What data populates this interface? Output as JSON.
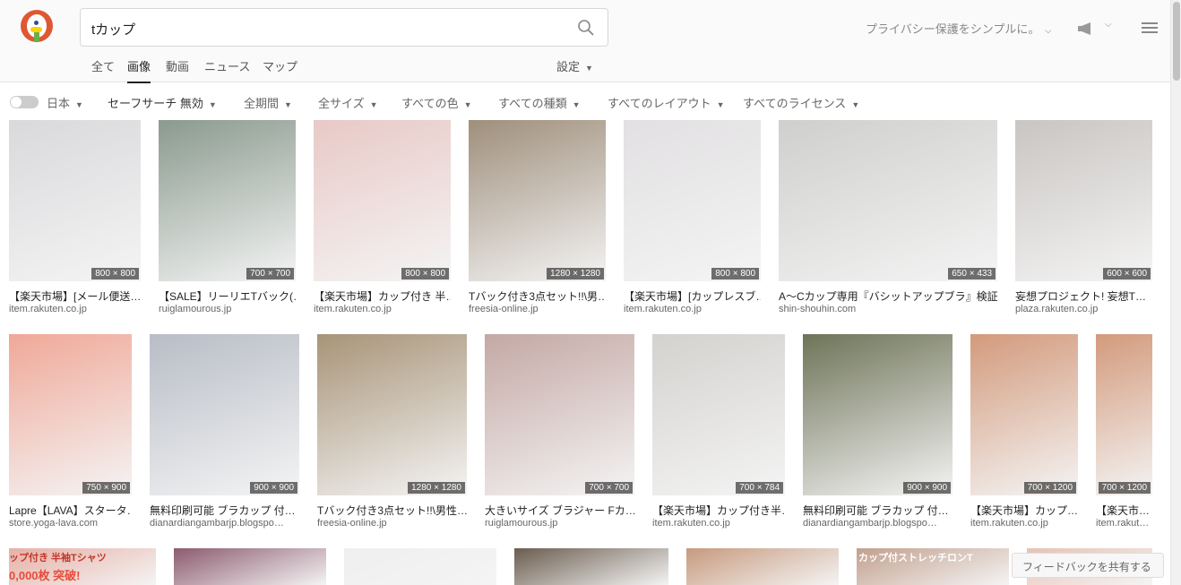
{
  "search": {
    "query": "tカップ"
  },
  "header": {
    "tagline": "プライバシー保護をシンプルに。"
  },
  "tabs": [
    {
      "label": "全て"
    },
    {
      "label": "画像"
    },
    {
      "label": "動画"
    },
    {
      "label": "ニュース"
    },
    {
      "label": "マップ"
    }
  ],
  "settings_label": "設定",
  "filters": [
    {
      "label": "日本"
    },
    {
      "label": "セーフサーチ 無効"
    },
    {
      "label": "全期間"
    },
    {
      "label": "全サイズ"
    },
    {
      "label": "すべての色"
    },
    {
      "label": "すべての種類"
    },
    {
      "label": "すべてのレイアウト"
    },
    {
      "label": "すべてのライセンス"
    }
  ],
  "results_row1": [
    {
      "title": "【楽天市場】[メール便送…",
      "source": "item.rakuten.co.jp",
      "dims": "800 × 800",
      "color": "#d9d9dc"
    },
    {
      "title": "【SALE】リーリエTバック(…",
      "source": "ruiglamourous.jp",
      "dims": "700 × 700",
      "color": "#8a9a8e"
    },
    {
      "title": "【楽天市場】カップ付き 半…",
      "source": "item.rakuten.co.jp",
      "dims": "800 × 800",
      "color": "#e8c9c6"
    },
    {
      "title": "Tバック付き3点セット!!\\男…",
      "source": "freesia-online.jp",
      "dims": "1280 × 1280",
      "color": "#9f8f7c"
    },
    {
      "title": "【楽天市場】[カップレスブ…",
      "source": "item.rakuten.co.jp",
      "dims": "800 × 800",
      "color": "#e2e0e2"
    },
    {
      "title": "A〜Cカップ専用『バシットアップブラ』検証…",
      "source": "shin-shouhin.com",
      "dims": "650 × 433",
      "color": "#cfcfcd"
    },
    {
      "title": "妄想プロジェクト! 妄想T…",
      "source": "plaza.rakuten.co.jp",
      "dims": "600 × 600",
      "color": "#c9c5c2"
    }
  ],
  "results_row2": [
    {
      "title": "Lapre【LAVA】スタータ…",
      "source": "store.yoga-lava.com",
      "dims": "750 × 900",
      "color": "#f0a898"
    },
    {
      "title": "無料印刷可能 ブラカップ 付…",
      "source": "dianardiangambarjp.blogspo…",
      "dims": "900 × 900",
      "color": "#b8bdc6"
    },
    {
      "title": "Tバック付き3点セット!!\\男性…",
      "source": "freesia-online.jp",
      "dims": "1280 × 1280",
      "color": "#a89478"
    },
    {
      "title": "大きいサイズ ブラジャー Fカ…",
      "source": "ruiglamourous.jp",
      "dims": "700 × 700",
      "color": "#c4a8a4"
    },
    {
      "title": "【楽天市場】カップ付き半…",
      "source": "item.rakuten.co.jp",
      "dims": "700 × 784",
      "color": "#d4d2cf"
    },
    {
      "title": "無料印刷可能 ブラカップ 付…",
      "source": "dianardiangambarjp.blogspo…",
      "dims": "900 × 900",
      "color": "#6e7458"
    },
    {
      "title": "【楽天市場】カップ…",
      "source": "item.rakuten.co.jp",
      "dims": "700 × 1200",
      "color": "#d39a7c"
    },
    {
      "title": "【楽天市…",
      "source": "item.rakut…",
      "dims": "700 × 1200",
      "color": "#d39a7c"
    }
  ],
  "results_row3": [
    {
      "color": "#e7b0a6",
      "overlay_text": "ップ付き 半袖Tシャツ",
      "overlay_text2": "0,000枚 突破!"
    },
    {
      "color": "#8c5b6f"
    },
    {
      "color": "#efefef"
    },
    {
      "color": "#6b5d4f"
    },
    {
      "color": "#c79a7e"
    },
    {
      "color": "#c2a08e",
      "overlay_text": "カップ付ストレッチロンT"
    },
    {
      "color": "#e6c2b4"
    }
  ],
  "feedback_label": "フィードバックを共有する"
}
